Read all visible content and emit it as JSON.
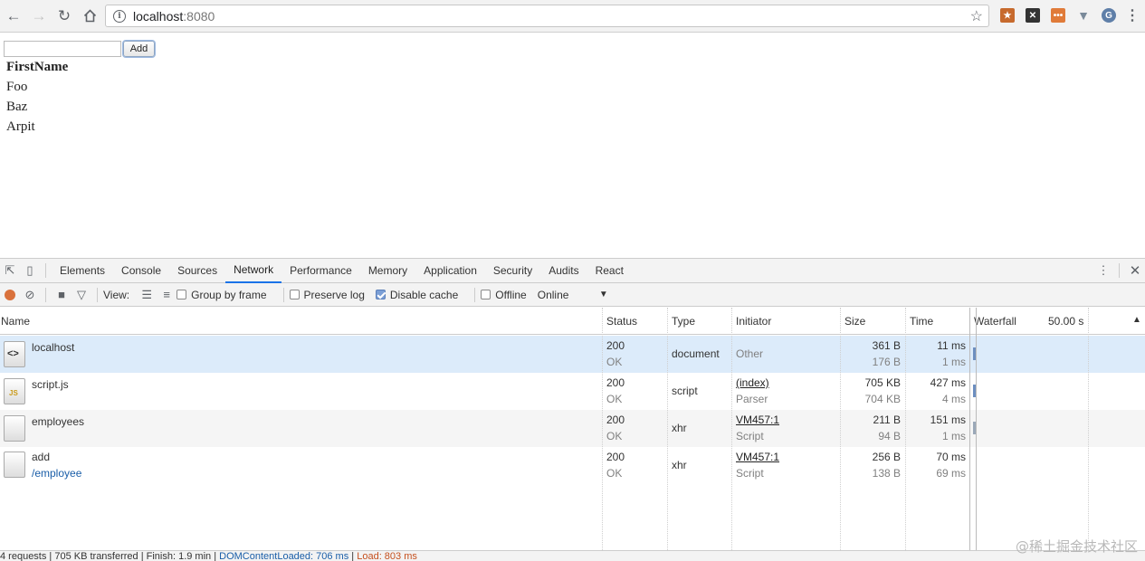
{
  "browser": {
    "url_host": "localhost",
    "url_port": ":8080"
  },
  "page": {
    "add_button": "Add",
    "input_value": "",
    "column_header": "FirstName",
    "names": [
      "Foo",
      "Baz",
      "Arpit"
    ]
  },
  "devtools": {
    "tabs": [
      "Elements",
      "Console",
      "Sources",
      "Network",
      "Performance",
      "Memory",
      "Application",
      "Security",
      "Audits",
      "React"
    ],
    "active_tab": "Network",
    "toolbar": {
      "view_label": "View:",
      "group_by_frame": "Group by frame",
      "preserve_log": "Preserve log",
      "disable_cache": "Disable cache",
      "offline": "Offline",
      "throttling": "Online"
    },
    "columns": {
      "name": "Name",
      "status": "Status",
      "type": "Type",
      "initiator": "Initiator",
      "size": "Size",
      "time": "Time",
      "waterfall": "Waterfall",
      "waterfall_scale": "50.00 s"
    },
    "requests": [
      {
        "name": "localhost",
        "path": "",
        "status": "200",
        "status_text": "OK",
        "type": "document",
        "initiator": "Other",
        "initiator_sub": "",
        "size": "361 B",
        "size_sub": "176 B",
        "time": "11 ms",
        "time_sub": "1 ms",
        "icon": "html-file-icon"
      },
      {
        "name": "script.js",
        "path": "",
        "status": "200",
        "status_text": "OK",
        "type": "script",
        "initiator": "(index)",
        "initiator_sub": "Parser",
        "size": "705 KB",
        "size_sub": "704 KB",
        "time": "427 ms",
        "time_sub": "4 ms",
        "icon": "js-file-icon"
      },
      {
        "name": "employees",
        "path": "",
        "status": "200",
        "status_text": "OK",
        "type": "xhr",
        "initiator": "VM457:1",
        "initiator_sub": "Script",
        "size": "211 B",
        "size_sub": "94 B",
        "time": "151 ms",
        "time_sub": "1 ms",
        "icon": "file-icon"
      },
      {
        "name": "add",
        "path": "/employee",
        "status": "200",
        "status_text": "OK",
        "type": "xhr",
        "initiator": "VM457:1",
        "initiator_sub": "Script",
        "size": "256 B",
        "size_sub": "138 B",
        "time": "70 ms",
        "time_sub": "69 ms",
        "icon": "file-icon"
      }
    ],
    "footer": {
      "summary": "4 requests | 705 KB transferred | Finish: 1.9 min | ",
      "dcl": "DOMContentLoaded: 706 ms",
      "sep": " | ",
      "load": "Load: 803 ms"
    }
  },
  "watermark": "@稀土掘金技术社区"
}
